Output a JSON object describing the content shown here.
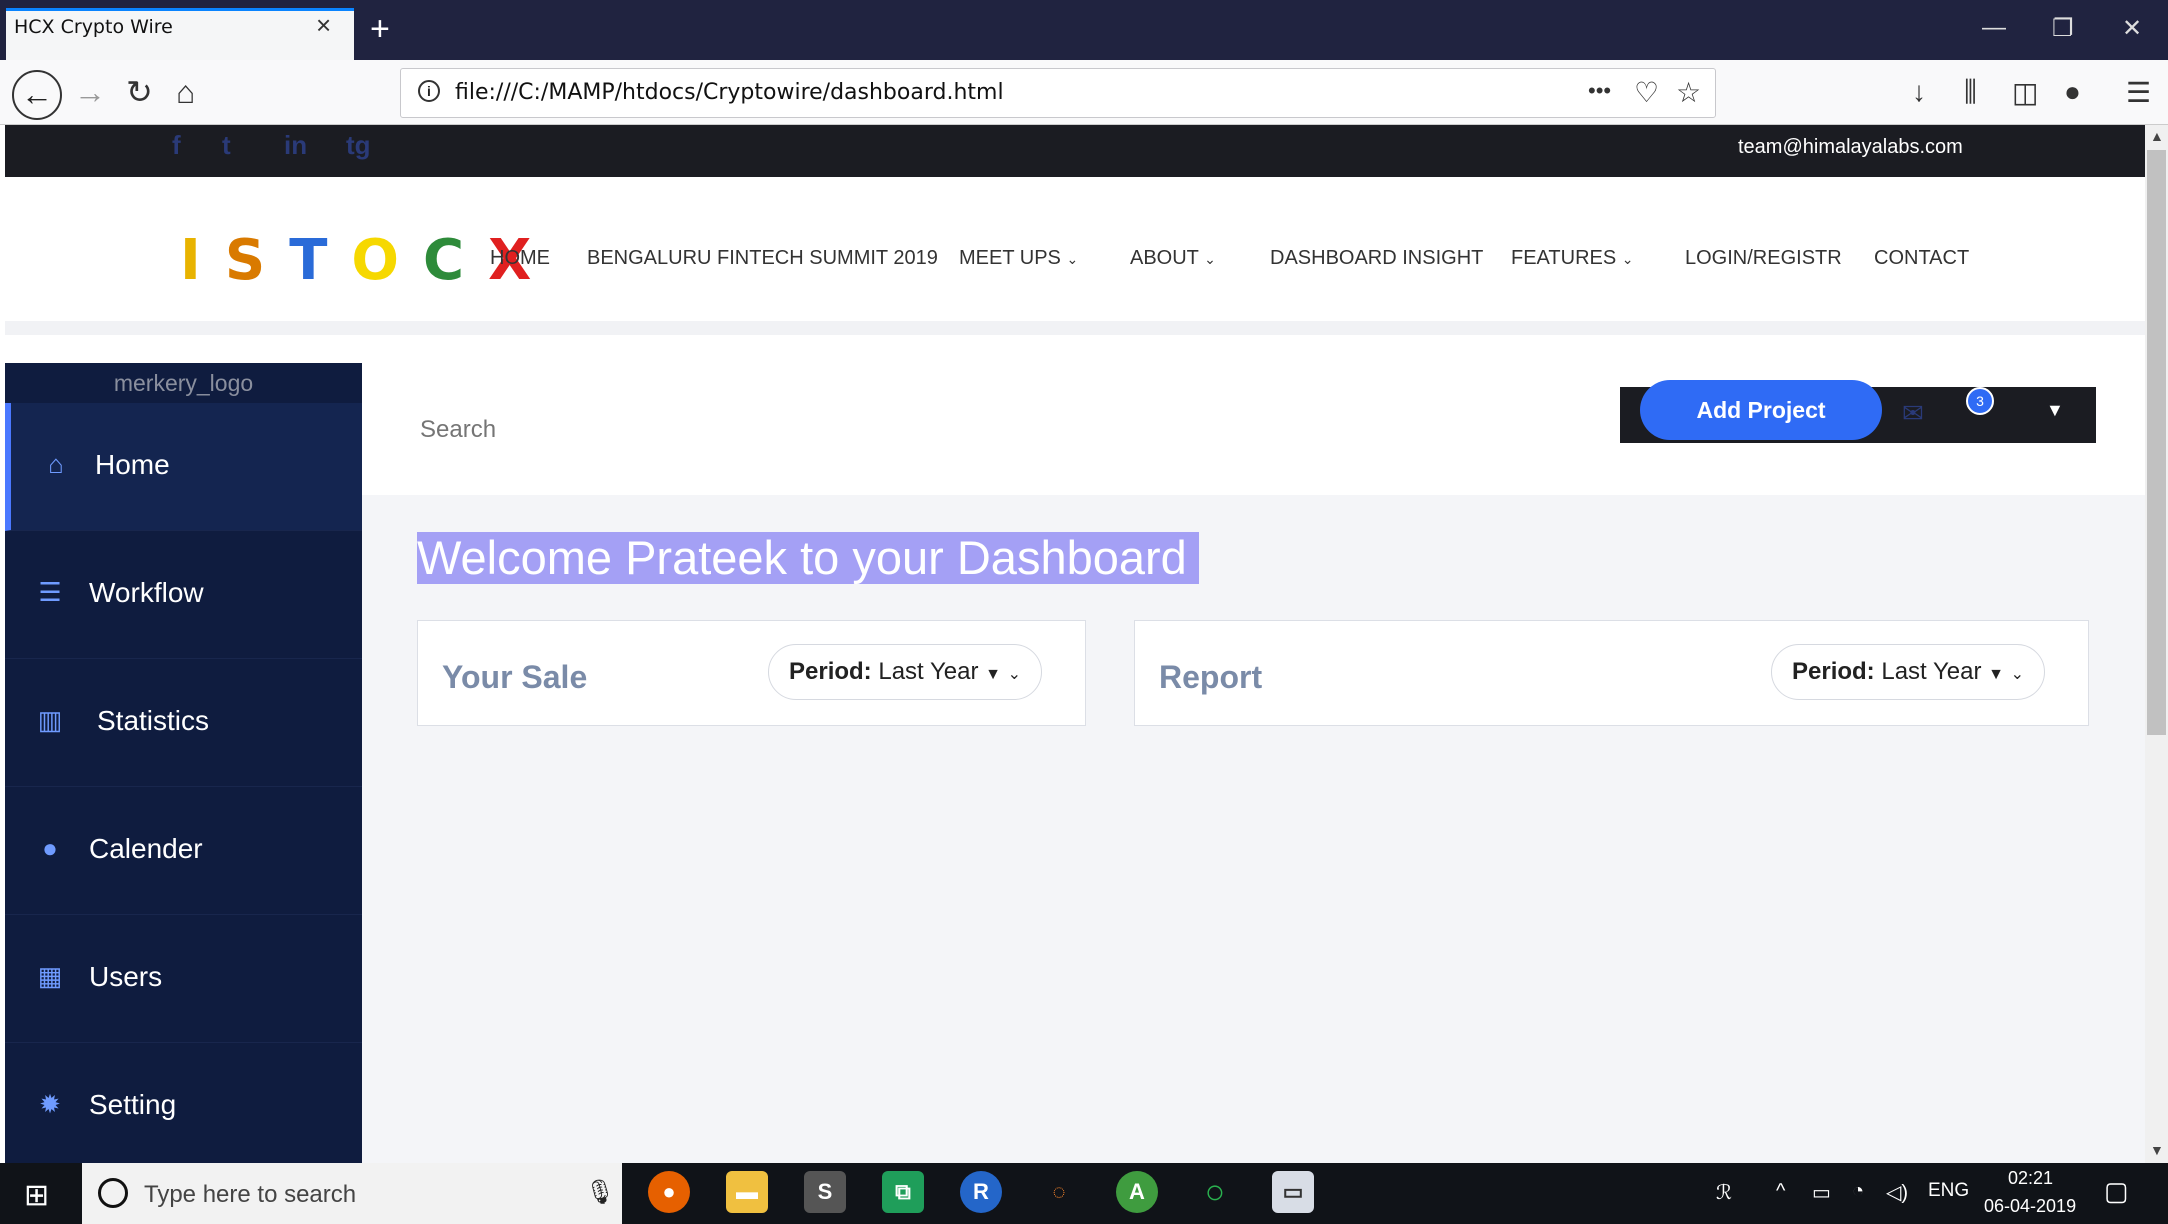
{
  "browser": {
    "tab_title": "HCX Crypto Wire",
    "tab_close": "×",
    "new_tab": "+",
    "url": "file:///C:/MAMP/htdocs/Cryptowire/dashboard.html",
    "url_actions": "•••"
  },
  "site": {
    "email": "team@himalayalabs.com",
    "social": [
      "f",
      "t",
      "in",
      "tg"
    ],
    "logo_letters": [
      {
        "char": "I",
        "color": "#e8b300"
      },
      {
        "char": "S",
        "color": "#d97a00"
      },
      {
        "char": "T",
        "color": "#2a6bd8"
      },
      {
        "char": "O",
        "color": "#f6d800"
      },
      {
        "char": "C",
        "color": "#2e8b3a"
      },
      {
        "char": "X",
        "color": "#e02020"
      }
    ],
    "menu": [
      {
        "label": "HOME",
        "dropdown": false
      },
      {
        "label": "BENGALURU FINTECH SUMMIT 2019",
        "dropdown": false
      },
      {
        "label": "MEET UPS",
        "dropdown": true
      },
      {
        "label": "ABOUT",
        "dropdown": true
      },
      {
        "label": "DASHBOARD INSIGHT",
        "dropdown": false
      },
      {
        "label": "FEATURES",
        "dropdown": true
      },
      {
        "label": "LOGIN/REGISTR",
        "dropdown": false
      },
      {
        "label": "CONTACT",
        "dropdown": false
      }
    ]
  },
  "sidebar": {
    "logo_alt": "merkery_logo",
    "items": [
      {
        "label": "Home",
        "icon": "home-icon",
        "active": true
      },
      {
        "label": "Workflow",
        "icon": "workflow-icon",
        "active": false
      },
      {
        "label": "Statistics",
        "icon": "bar-chart-icon",
        "active": false
      },
      {
        "label": "Calender",
        "icon": "user-icon",
        "active": false
      },
      {
        "label": "Users",
        "icon": "calendar-icon",
        "active": false
      },
      {
        "label": "Setting",
        "icon": "gear-icon",
        "active": false
      }
    ]
  },
  "header": {
    "search_placeholder": "Search",
    "add_project_label": "Add Project",
    "notification_count": "3"
  },
  "main": {
    "welcome": "Welcome Prateek to your Dashboard",
    "cards": [
      {
        "title": "Your Sale",
        "period_label": "Period:",
        "period_value": "Last Year"
      },
      {
        "title": "Report",
        "period_label": "Period:",
        "period_value": "Last Year"
      }
    ]
  },
  "taskbar": {
    "search_placeholder": "Type here to search",
    "language": "ENG",
    "time": "02:21",
    "date": "06-04-2019"
  },
  "colors": {
    "sidebar_bg": "#0f1c3f",
    "accent": "#2f6bf5",
    "welcome_highlight": "#a4a0f5"
  }
}
